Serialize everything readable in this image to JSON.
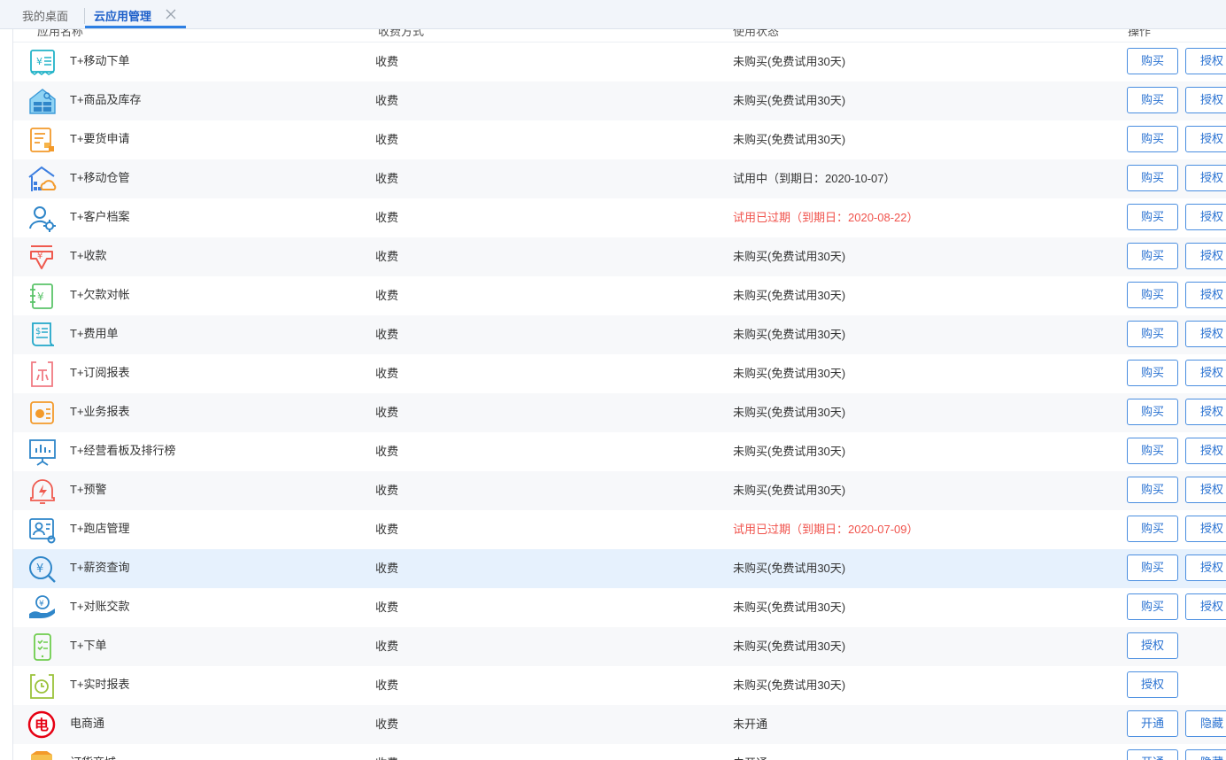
{
  "tabs": {
    "home": "我的桌面",
    "active": "云应用管理"
  },
  "table": {
    "columns": [
      "应用名称",
      "收费方式",
      "使用状态",
      "操作"
    ],
    "rows": [
      {
        "name": "T+移动下单",
        "fee": "收费",
        "status": "未购买(免费试用30天)",
        "expired": false,
        "icon": "receipt-yuan-icon",
        "actions": [
          "购买",
          "授权"
        ]
      },
      {
        "name": "T+商品及库存",
        "fee": "收费",
        "status": "未购买(免费试用30天)",
        "expired": false,
        "icon": "warehouse-search-icon",
        "actions": [
          "购买",
          "授权"
        ]
      },
      {
        "name": "T+要货申请",
        "fee": "收费",
        "status": "未购买(免费试用30天)",
        "expired": false,
        "icon": "request-form-icon",
        "actions": [
          "购买",
          "授权"
        ]
      },
      {
        "name": "T+移动仓管",
        "fee": "收费",
        "status": "试用中（到期日：2020-10-07）",
        "expired": false,
        "icon": "cloud-warehouse-icon",
        "actions": [
          "购买",
          "授权"
        ]
      },
      {
        "name": "T+客户档案",
        "fee": "收费",
        "status": "试用已过期（到期日：2020-08-22）",
        "expired": true,
        "icon": "customer-settings-icon",
        "actions": [
          "购买",
          "授权"
        ]
      },
      {
        "name": "T+收款",
        "fee": "收费",
        "status": "未购买(免费试用30天)",
        "expired": false,
        "icon": "payment-down-icon",
        "actions": [
          "购买",
          "授权"
        ]
      },
      {
        "name": "T+欠款对帐",
        "fee": "收费",
        "status": "未购买(免费试用30天)",
        "expired": false,
        "icon": "ledger-yuan-icon",
        "actions": [
          "购买",
          "授权"
        ]
      },
      {
        "name": "T+费用单",
        "fee": "收费",
        "status": "未购买(免费试用30天)",
        "expired": false,
        "icon": "expense-scroll-icon",
        "actions": [
          "购买",
          "授权"
        ]
      },
      {
        "name": "T+订阅报表",
        "fee": "收费",
        "status": "未购买(免费试用30天)",
        "expired": false,
        "icon": "subscription-report-icon",
        "actions": [
          "购买",
          "授权"
        ]
      },
      {
        "name": "T+业务报表",
        "fee": "收费",
        "status": "未购买(免费试用30天)",
        "expired": false,
        "icon": "business-report-icon",
        "actions": [
          "购买",
          "授权"
        ]
      },
      {
        "name": "T+经营看板及排行榜",
        "fee": "收费",
        "status": "未购买(免费试用30天)",
        "expired": false,
        "icon": "dashboard-board-icon",
        "actions": [
          "购买",
          "授权"
        ]
      },
      {
        "name": "T+预警",
        "fee": "收费",
        "status": "未购买(免费试用30天)",
        "expired": false,
        "icon": "alert-bell-icon",
        "actions": [
          "购买",
          "授权"
        ]
      },
      {
        "name": "T+跑店管理",
        "fee": "收费",
        "status": "试用已过期（到期日：2020-07-09）",
        "expired": true,
        "icon": "store-visit-icon",
        "actions": [
          "购买",
          "授权"
        ]
      },
      {
        "name": "T+薪资查询",
        "fee": "收费",
        "status": "未购买(免费试用30天)",
        "expired": false,
        "icon": "salary-search-icon",
        "actions": [
          "购买",
          "授权"
        ]
      },
      {
        "name": "T+对账交款",
        "fee": "收费",
        "status": "未购买(免费试用30天)",
        "expired": false,
        "icon": "hand-coin-icon",
        "actions": [
          "购买",
          "授权"
        ]
      },
      {
        "name": "T+下单",
        "fee": "收费",
        "status": "未购买(免费试用30天)",
        "expired": false,
        "icon": "phone-checklist-icon",
        "actions": [
          "授权"
        ]
      },
      {
        "name": "T+实时报表",
        "fee": "收费",
        "status": "未购买(免费试用30天)",
        "expired": false,
        "icon": "realtime-report-icon",
        "actions": [
          "授权"
        ]
      },
      {
        "name": "电商通",
        "fee": "收费",
        "status": "未开通",
        "expired": false,
        "icon": "ecommerce-badge-icon",
        "actions": [
          "开通",
          "隐藏"
        ]
      },
      {
        "name": "订货商城",
        "fee": "收费",
        "status": "未开通",
        "expired": false,
        "icon": "order-mall-icon",
        "actions": [
          "开通",
          "隐藏"
        ]
      }
    ]
  },
  "colors": {
    "accent": "#2a72d1",
    "expired": "#f0524b",
    "stripe": "#f7f8fa",
    "hover": "#e6f1fd"
  }
}
